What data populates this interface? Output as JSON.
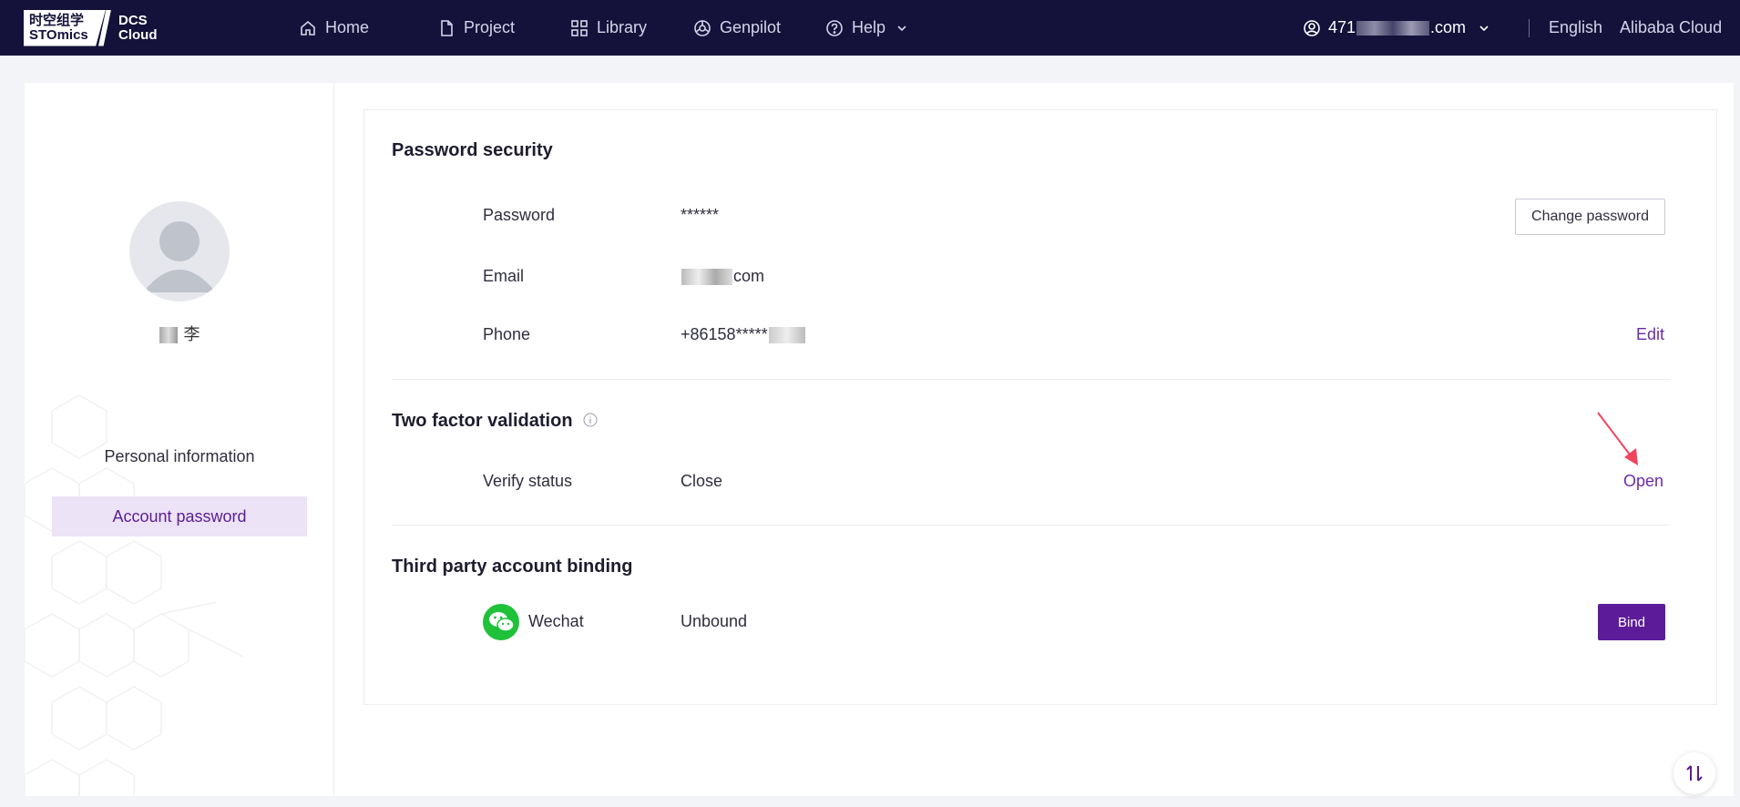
{
  "brand": {
    "logo_cn": "时空组学",
    "logo_en": "STOmics",
    "product_line1": "DCS",
    "product_line2": "Cloud"
  },
  "nav": [
    {
      "label": "Home",
      "icon": "home-icon"
    },
    {
      "label": "Project",
      "icon": "document-icon"
    },
    {
      "label": "Library",
      "icon": "grid-icon"
    },
    {
      "label": "Genpilot",
      "icon": "globe-icon"
    },
    {
      "label": "Help",
      "icon": "help-icon"
    }
  ],
  "user": {
    "email_prefix": "471",
    "email_suffix": ".com"
  },
  "top_links": {
    "language": "English",
    "cloud": "Alibaba Cloud"
  },
  "sidebar": {
    "username_visible": "李",
    "items": [
      {
        "label": "Personal information",
        "active": false
      },
      {
        "label": "Account password",
        "active": true
      }
    ]
  },
  "password_security": {
    "title": "Password security",
    "rows": [
      {
        "label": "Password",
        "value": "******"
      },
      {
        "label": "Email",
        "value": "com"
      },
      {
        "label": "Phone",
        "value": "+86158*****"
      }
    ],
    "change_password_label": "Change password",
    "edit_label": "Edit"
  },
  "two_factor": {
    "title": "Two factor validation",
    "label": "Verify status",
    "value": "Close",
    "action": "Open"
  },
  "third_party": {
    "title": "Third party account binding",
    "provider": "Wechat",
    "status": "Unbound",
    "action": "Bind"
  },
  "colors": {
    "topbar": "#14123a",
    "accent": "#5c1c9a",
    "link": "#6b2ba8",
    "wechat": "#1fc13a",
    "arrow": "#f0445f"
  }
}
